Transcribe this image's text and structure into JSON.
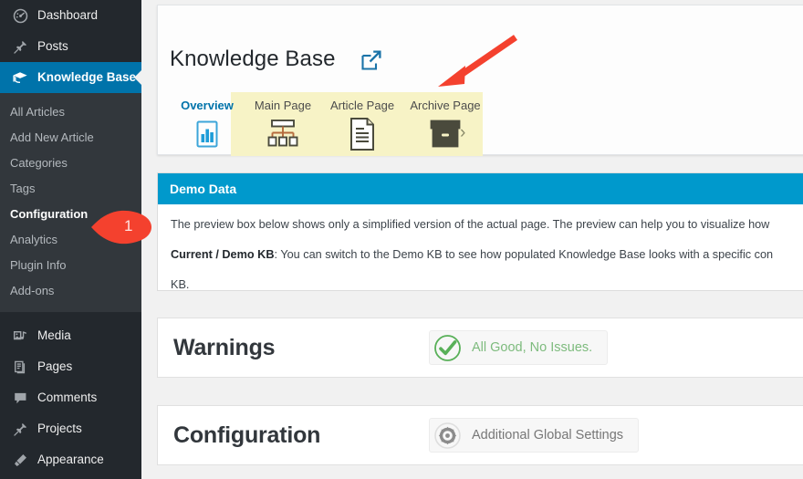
{
  "sidebar": {
    "top_items": [
      {
        "label": "Dashboard",
        "icon": "dashboard-icon"
      },
      {
        "label": "Posts",
        "icon": "pin-icon"
      }
    ],
    "active_item": {
      "label": "Knowledge Base",
      "icon": "graduation-cap-icon"
    },
    "submenu": [
      {
        "label": "All Articles",
        "current": false
      },
      {
        "label": "Add New Article",
        "current": false
      },
      {
        "label": "Categories",
        "current": false
      },
      {
        "label": "Tags",
        "current": false
      },
      {
        "label": "Configuration",
        "current": true
      },
      {
        "label": "Analytics",
        "current": false
      },
      {
        "label": "Plugin Info",
        "current": false
      },
      {
        "label": "Add-ons",
        "current": false
      }
    ],
    "bottom_items": [
      {
        "label": "Media",
        "icon": "media-icon"
      },
      {
        "label": "Pages",
        "icon": "pages-icon"
      },
      {
        "label": "Comments",
        "icon": "comment-icon"
      },
      {
        "label": "Projects",
        "icon": "pin-icon"
      },
      {
        "label": "Appearance",
        "icon": "brush-icon"
      }
    ],
    "colors": {
      "background": "#23282d",
      "submenu_background": "#32373c",
      "active_background": "#0073aa",
      "text": "#b4b9be"
    }
  },
  "header": {
    "title": "Knowledge Base",
    "external_link_icon": "external-link-icon"
  },
  "tabs": [
    {
      "id": "overview",
      "label": "Overview",
      "icon": "bar-chart-icon",
      "active": true
    },
    {
      "id": "main",
      "label": "Main Page",
      "icon": "sitemap-icon",
      "active": false
    },
    {
      "id": "article",
      "label": "Article Page",
      "icon": "document-icon",
      "active": false
    },
    {
      "id": "archive",
      "label": "Archive Page",
      "icon": "archive-box-icon",
      "active": false
    }
  ],
  "tab_separator": "›",
  "demo_panel": {
    "header": "Demo Data",
    "paragraph_1": "The preview box below shows only a simplified version of the actual page. The preview can help you to visualize how",
    "paragraph_2_bold": "Current / Demo KB",
    "paragraph_2_rest": ": You can switch to the Demo KB to see how populated Knowledge Base looks with a specific con",
    "paragraph_2_wrap": "KB.",
    "header_color": "#0099cc"
  },
  "warnings_section": {
    "title": "Warnings",
    "pill_label": "All Good, No Issues.",
    "pill_icon": "check-circle-icon",
    "accent_color": "#58b058"
  },
  "configuration_section": {
    "title": "Configuration",
    "pill_label": "Additional Global Settings",
    "pill_icon": "gear-icon"
  },
  "annotations": {
    "arrow": {
      "name": "red-arrow-annotation",
      "color": "#f4412e",
      "points_to": "Archive Page"
    },
    "pin": {
      "number": "1",
      "color": "#f4412e",
      "points_to": "Configuration"
    }
  }
}
